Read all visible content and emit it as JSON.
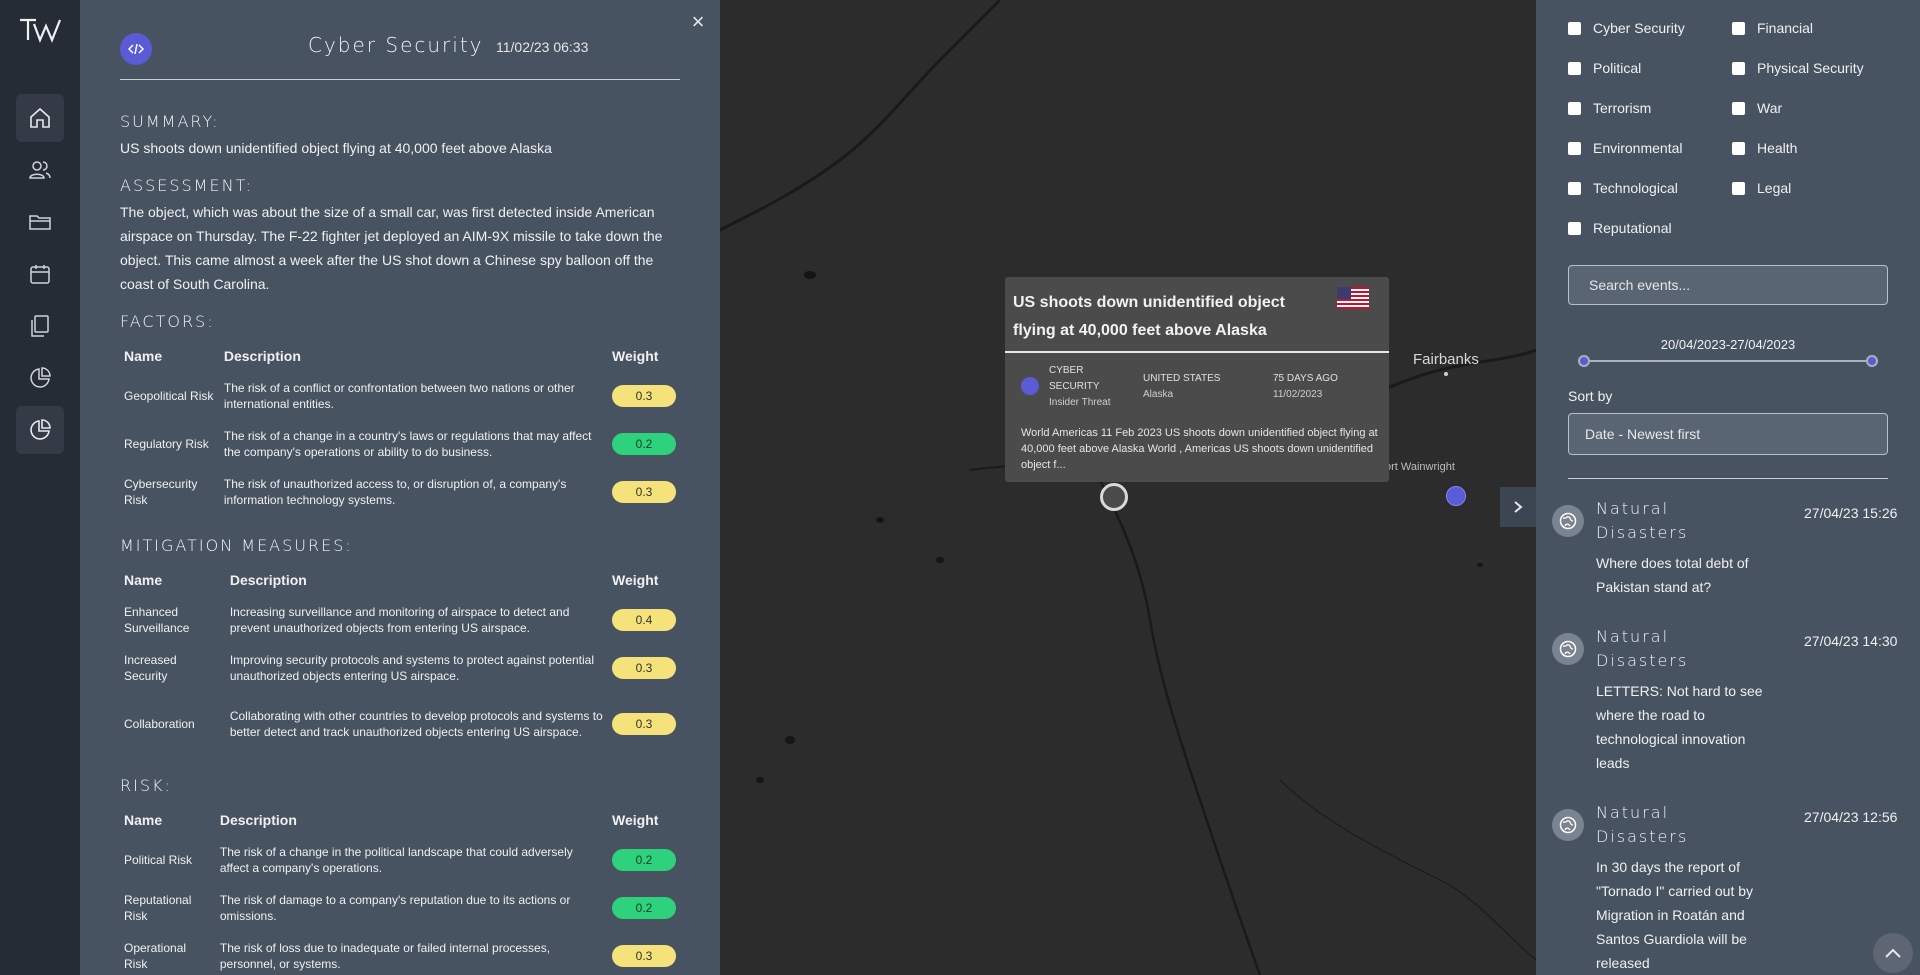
{
  "detail": {
    "category": "Cyber Security",
    "date": "11/02/23 06:33",
    "close": "×",
    "summary_heading": "SUMMARY:",
    "summary": "US shoots down unidentified object flying at 40,000 feet above Alaska",
    "assessment_heading": "ASSESSMENT:",
    "assessment": "The object, which was about the size of a small car, was first detected inside American airspace on Thursday. The F-22 fighter jet deployed an AIM-9X missile to take down the object. This came almost a week after the US shot down a Chinese spy balloon off the coast of South Carolina.",
    "factors_heading": "FACTORS:",
    "mitigation_heading": "MITIGATION MEASURES:",
    "risk_heading": "RISK:",
    "col_name": "Name",
    "col_description": "Description",
    "col_weight": "Weight",
    "factors": [
      {
        "name": "Geopolitical Risk",
        "description": "The risk of a conflict or confrontation between two nations or other international entities.",
        "weight": "0.3",
        "color": "#f5e27a"
      },
      {
        "name": "Regulatory Risk",
        "description": "The risk of a change in a country's laws or regulations that may affect the company's operations or ability to do business.",
        "weight": "0.2",
        "color": "#2ed17c"
      },
      {
        "name": "Cybersecurity Risk",
        "description": "The risk of unauthorized access to, or disruption of, a company's information technology systems.",
        "weight": "0.3",
        "color": "#f5e27a"
      }
    ],
    "mitigation": [
      {
        "name": "Enhanced Surveillance",
        "description": "Increasing surveillance and monitoring of airspace to detect and prevent unauthorized objects from entering US airspace.",
        "weight": "0.4",
        "color": "#f5e27a"
      },
      {
        "name": "Increased Security",
        "description": "Improving security protocols and systems to protect against potential unauthorized objects entering US airspace.",
        "weight": "0.3",
        "color": "#f5e27a"
      },
      {
        "name": "Collaboration",
        "description": "Collaborating with other countries to develop protocols and systems to better detect and track unauthorized objects entering US airspace.",
        "weight": "0.3",
        "color": "#f5e27a"
      }
    ],
    "risk": [
      {
        "name": "Political Risk",
        "description": "The risk of a change in the political landscape that could adversely affect a company's operations.",
        "weight": "0.2",
        "color": "#2ed17c"
      },
      {
        "name": "Reputational Risk",
        "description": "The risk of damage to a company's reputation due to its actions or omissions.",
        "weight": "0.2",
        "color": "#2ed17c"
      },
      {
        "name": "Operational Risk",
        "description": "The risk of loss due to inadequate or failed internal processes, personnel, or systems.",
        "weight": "0.3",
        "color": "#f5e27a"
      }
    ]
  },
  "popup": {
    "title": "US shoots down unidentified object flying at 40,000 feet above Alaska",
    "category_line1": "CYBER",
    "category_line2": "SECURITY",
    "subcategory": "Insider Threat",
    "country": "UNITED STATES",
    "region": "Alaska",
    "ago": "75 DAYS AGO",
    "date": "11/02/2023",
    "body": "World Americas 11 Feb 2023 US shoots down unidentified object flying at 40,000 feet above Alaska World , Americas US shoots down unidentified object f..."
  },
  "map": {
    "city1": "Fairbanks",
    "city2": "ort Wainwright"
  },
  "filters": {
    "left": [
      "Cyber Security",
      "Political",
      "Terrorism",
      "Environmental",
      "Technological",
      "Reputational"
    ],
    "right": [
      "Financial",
      "Physical Security",
      "War",
      "Health",
      "Legal"
    ],
    "search_placeholder": "Search events...",
    "date_range": "20/04/2023-27/04/2023",
    "sort_label": "Sort by",
    "sort_value": "Date - Newest first"
  },
  "events": [
    {
      "category": "Natural Disasters",
      "date": "27/04/23 15:26",
      "title": "Where does total debt of Pakistan stand at?"
    },
    {
      "category": "Natural Disasters",
      "date": "27/04/23 14:30",
      "title": "LETTERS: Not hard to see where the road to technological innovation leads"
    },
    {
      "category": "Natural Disasters",
      "date": "27/04/23 12:56",
      "title": "In 30 days the report of \"Tornado I\" carried out by Migration in Roatán and Santos Guardiola will be released"
    }
  ],
  "colors": {
    "accent": "#5b5bd6",
    "panel": "#485361",
    "sidebar": "#262c36",
    "map": "#2c2c2c",
    "weight_yellow": "#f5e27a",
    "weight_green": "#2ed17c"
  }
}
